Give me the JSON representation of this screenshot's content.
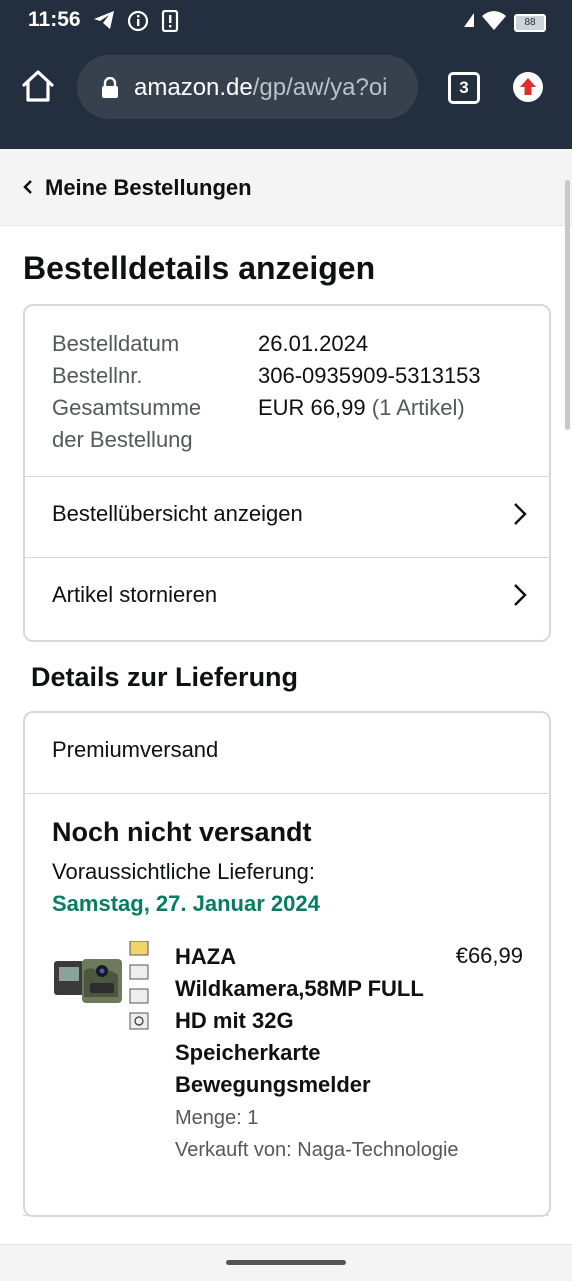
{
  "status_bar": {
    "time": "11:56",
    "battery": "88",
    "icons": [
      "telegram-icon",
      "info-icon",
      "sim-alert-icon",
      "signal-icon",
      "wifi-icon",
      "battery-icon"
    ]
  },
  "browser": {
    "url_host": "amazon.de",
    "url_path": "/gp/aw/ya?oi",
    "tab_count": "3"
  },
  "breadcrumb": {
    "label": "Meine Bestellungen"
  },
  "page": {
    "title": "Bestelldetails anzeigen"
  },
  "order": {
    "date_label": "Bestelldatum",
    "date_value": "26.01.2024",
    "number_label": "Bestellnr.",
    "number_value": "306-0935909-5313153",
    "total_label_1": "Gesamtsumme",
    "total_label_2": "der Bestellung",
    "total_value": "EUR 66,99",
    "total_items": "(1 Artikel)"
  },
  "links": {
    "overview": "Bestellübersicht anzeigen",
    "cancel": "Artikel stornieren"
  },
  "delivery": {
    "section_title": "Details zur Lieferung",
    "shipping_type": "Premiumversand",
    "status": "Noch nicht versandt",
    "eta_label": "Voraussichtliche Lieferung:",
    "eta_date": "Samstag, 27. Januar 2024"
  },
  "product": {
    "title": "HAZA Wildkamera,58MP FULL HD mit 32G Speicherkarte Bewegungsmelder",
    "price": "€66,99",
    "quantity": "Menge: 1",
    "seller": "Verkauft von: Naga-Technologie"
  },
  "colors": {
    "header_bg": "#232f3e",
    "eta_green": "#067d62",
    "update_red": "#e02d2d"
  }
}
